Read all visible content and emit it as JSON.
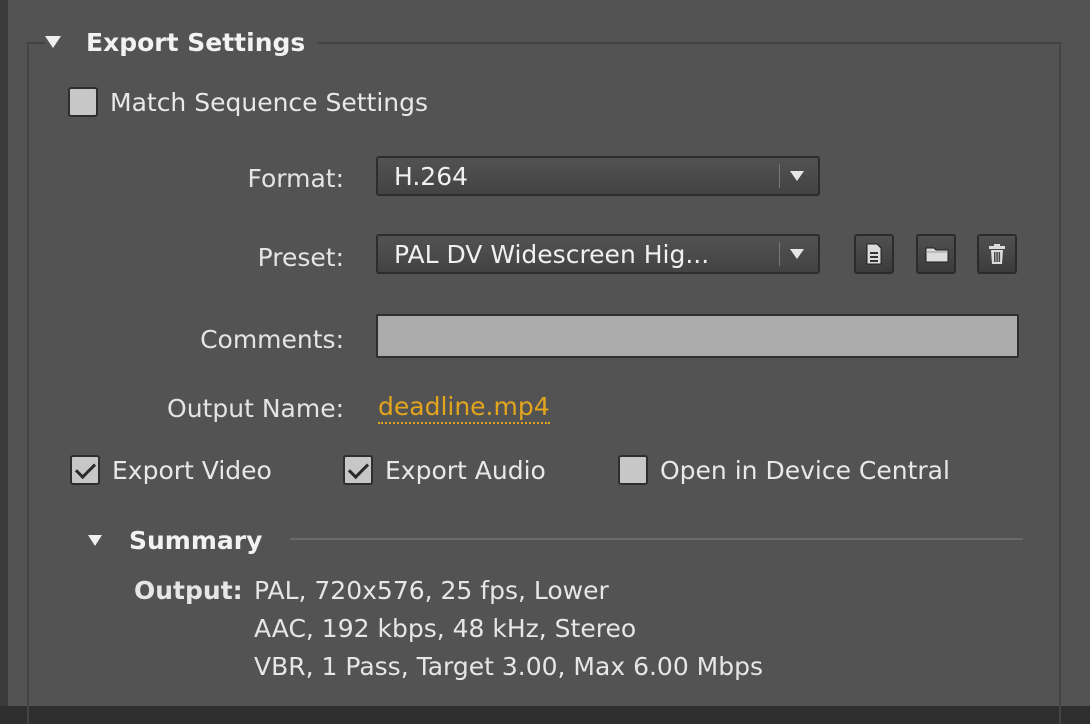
{
  "export_settings": {
    "title": "Export Settings",
    "match_sequence": {
      "label": "Match Sequence Settings",
      "checked": false
    },
    "format": {
      "label": "Format:",
      "value": "H.264"
    },
    "preset": {
      "label": "Preset:",
      "value": "PAL DV Widescreen Hig..."
    },
    "comments": {
      "label": "Comments:",
      "value": ""
    },
    "output_name": {
      "label": "Output Name:",
      "value": "deadline.mp4"
    },
    "export_video": {
      "label": "Export Video",
      "checked": true
    },
    "export_audio": {
      "label": "Export Audio",
      "checked": true
    },
    "device_central": {
      "label": "Open in Device Central",
      "checked": false
    }
  },
  "summary": {
    "title": "Summary",
    "output_label": "Output:",
    "lines": [
      "PAL, 720x576, 25 fps, Lower",
      "AAC, 192 kbps, 48 kHz, Stereo",
      "VBR, 1 Pass, Target 3.00, Max 6.00 Mbps"
    ]
  },
  "icons": [
    "save-preset-icon",
    "import-preset-icon",
    "delete-preset-icon"
  ],
  "colors": {
    "panel": "#535353",
    "link": "#e3a51d",
    "input": "#ababab"
  }
}
